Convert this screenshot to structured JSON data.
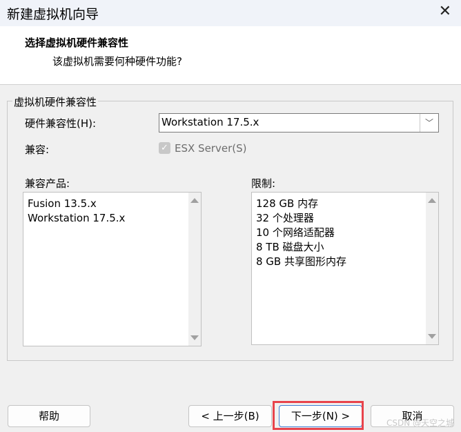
{
  "window": {
    "title": "新建虚拟机向导",
    "close_glyph": "✕"
  },
  "header": {
    "title": "选择虚拟机硬件兼容性",
    "subtitle": "该虚拟机需要何种硬件功能?"
  },
  "group": {
    "legend": "虚拟机硬件兼容性",
    "hardware_label": "硬件兼容性(H):",
    "hardware_value": "Workstation 17.5.x",
    "compatible_label": "兼容:",
    "esx_label": "ESX Server(S)",
    "esx_checked": true,
    "esx_enabled": false,
    "products_label": "兼容产品:",
    "products": [
      "Fusion 13.5.x",
      "Workstation 17.5.x"
    ],
    "limits_label": "限制:",
    "limits": [
      "128 GB 内存",
      "32 个处理器",
      "10 个网络适配器",
      "8 TB 磁盘大小",
      "8 GB 共享图形内存"
    ]
  },
  "buttons": {
    "help": "帮助",
    "back": "< 上一步(B)",
    "next": "下一步(N) >",
    "cancel": "取消"
  },
  "watermark": "CSDN @天空之城",
  "colors": {
    "highlight": "#e8434b"
  }
}
